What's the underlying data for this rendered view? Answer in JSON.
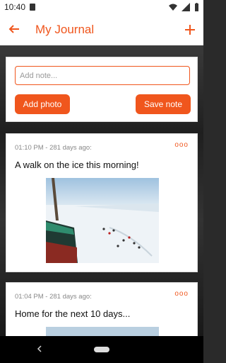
{
  "status_bar": {
    "time": "10:40"
  },
  "app_bar": {
    "title": "My Journal"
  },
  "composer": {
    "placeholder": "Add note...",
    "add_photo_label": "Add photo",
    "save_note_label": "Save note"
  },
  "entries": [
    {
      "meta": "01:10 PM - 281 days ago:",
      "text": "A walk on the ice this morning!"
    },
    {
      "meta": "01:04 PM - 281 days ago:",
      "text": "Home for the next 10 days..."
    }
  ],
  "colors": {
    "accent": "#f0561d"
  },
  "icons": {
    "more": "ooo"
  }
}
